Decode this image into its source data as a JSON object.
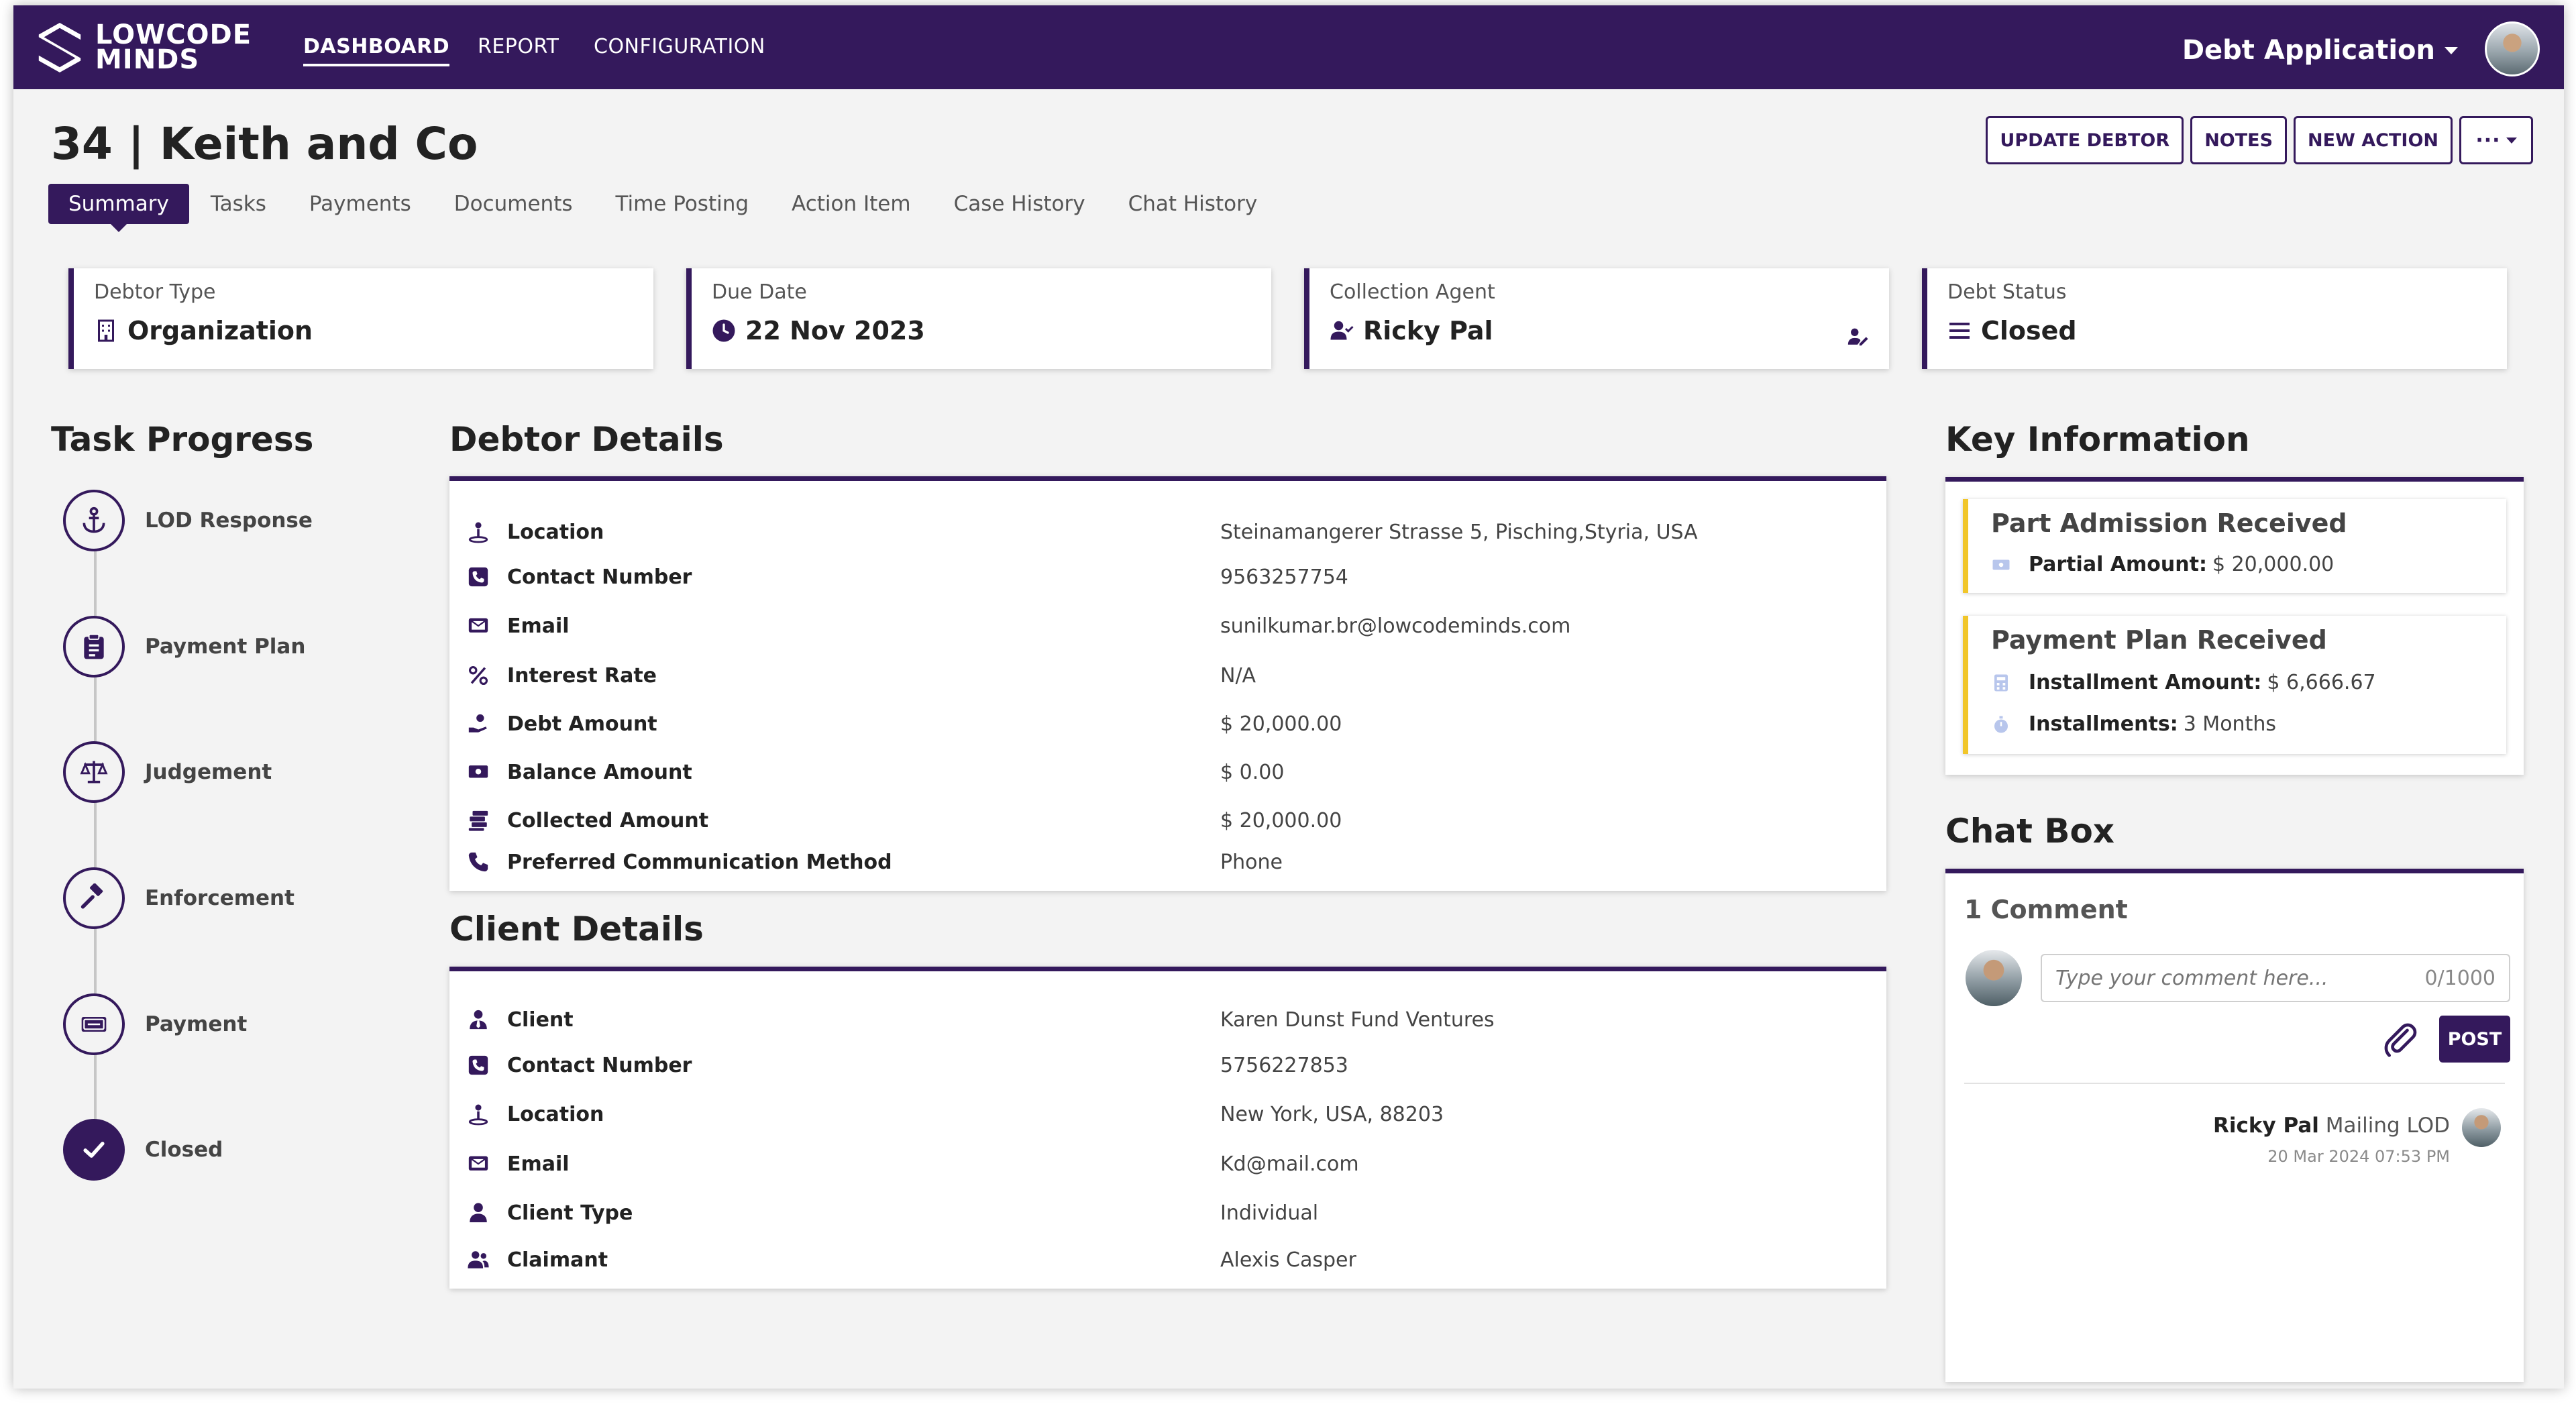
{
  "nav": {
    "logo_line1": "LOWCODE",
    "logo_line2": "MINDS",
    "items": [
      "DASHBOARD",
      "REPORT",
      "CONFIGURATION"
    ],
    "active": "DASHBOARD",
    "app_switcher": "Debt Application"
  },
  "header": {
    "title": "34 | Keith and Co",
    "actions": [
      "UPDATE DEBTOR",
      "NOTES",
      "NEW ACTION",
      "···"
    ]
  },
  "tabs": [
    "Summary",
    "Tasks",
    "Payments",
    "Documents",
    "Time Posting",
    "Action Item",
    "Case History",
    "Chat History"
  ],
  "stats": [
    {
      "label": "Debtor Type",
      "value": "Organization",
      "icon": "building-icon"
    },
    {
      "label": "Due Date",
      "value": "22 Nov 2023",
      "icon": "clock-icon"
    },
    {
      "label": "Collection Agent",
      "value": "Ricky Pal",
      "icon": "user-check-icon"
    },
    {
      "label": "Debt Status",
      "value": "Closed",
      "icon": "list-icon"
    }
  ],
  "task_progress": {
    "title": "Task Progress",
    "steps": [
      {
        "label": "LOD Response",
        "icon": "anchor-icon"
      },
      {
        "label": "Payment Plan",
        "icon": "clipboard-icon"
      },
      {
        "label": "Judgement",
        "icon": "scale-icon"
      },
      {
        "label": "Enforcement",
        "icon": "gavel-icon"
      },
      {
        "label": "Payment",
        "icon": "cash-icon"
      },
      {
        "label": "Closed",
        "icon": "check-icon"
      }
    ]
  },
  "debtor_details": {
    "title": "Debtor Details",
    "rows": [
      {
        "label": "Location",
        "value": "Steinamangerer Strasse 5, Pisching,Styria, USA",
        "icon": "location-icon"
      },
      {
        "label": "Contact Number",
        "value": "9563257754",
        "icon": "phone-square-icon"
      },
      {
        "label": "Email",
        "value": "sunilkumar.br@lowcodeminds.com",
        "icon": "envelope-icon"
      },
      {
        "label": "Interest Rate",
        "value": "N/A",
        "icon": "percent-icon"
      },
      {
        "label": "Debt Amount",
        "value": "$ 20,000.00",
        "icon": "hand-coin-icon"
      },
      {
        "label": "Balance Amount",
        "value": "$ 0.00",
        "icon": "money-icon"
      },
      {
        "label": "Collected Amount",
        "value": "$ 20,000.00",
        "icon": "coins-icon"
      },
      {
        "label": "Preferred Communication Method",
        "value": "Phone",
        "icon": "phone-icon"
      }
    ]
  },
  "client_details": {
    "title": "Client Details",
    "rows": [
      {
        "label": "Client",
        "value": "Karen Dunst Fund Ventures",
        "icon": "user-tie-icon"
      },
      {
        "label": "Contact Number",
        "value": "5756227853",
        "icon": "phone-square-icon"
      },
      {
        "label": "Location",
        "value": "New York, USA, 88203",
        "icon": "location-icon"
      },
      {
        "label": "Email",
        "value": "Kd@mail.com",
        "icon": "envelope-icon"
      },
      {
        "label": "Client Type",
        "value": "Individual",
        "icon": "user-icon"
      },
      {
        "label": "Claimant",
        "value": "Alexis Casper",
        "icon": "users-icon"
      }
    ]
  },
  "key_information": {
    "title": "Key Information",
    "cards": [
      {
        "title": "Part Admission Received",
        "lines": [
          {
            "label": "Partial Amount:",
            "value": "$ 20,000.00"
          }
        ]
      },
      {
        "title": "Payment Plan Received",
        "lines": [
          {
            "label": "Installment Amount:",
            "value": "$ 6,666.67"
          },
          {
            "label": "Installments:",
            "value": "3 Months"
          }
        ]
      }
    ]
  },
  "chat": {
    "title": "Chat Box",
    "count": "1 Comment",
    "placeholder": "Type your comment here...",
    "char_count": "0/1000",
    "post_label": "POST",
    "message": {
      "author": "Ricky Pal",
      "text": "Mailing LOD",
      "time": "20 Mar 2024 07:53 PM"
    }
  },
  "colors": {
    "brand": "#34195c",
    "highlight": "#f1c62a",
    "background": "#f3f3f3"
  }
}
